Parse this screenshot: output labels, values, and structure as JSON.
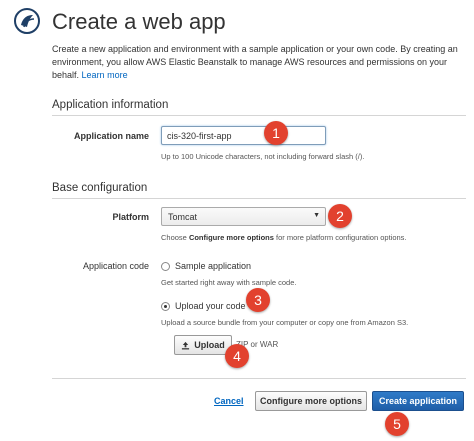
{
  "header": {
    "title": "Create a web app",
    "intro": "Create a new application and environment with a sample application or your own code. By creating an environment, you allow AWS Elastic Beanstalk to manage AWS resources and permissions on your behalf.",
    "learn_more": "Learn more"
  },
  "app_info": {
    "section_title": "Application information",
    "name_label": "Application name",
    "name_value": "cis-320-first-app",
    "name_hint": "Up to 100 Unicode characters, not including forward slash (/)."
  },
  "base_config": {
    "section_title": "Base configuration",
    "platform_label": "Platform",
    "platform_value": "Tomcat",
    "platform_hint_pre": "Choose ",
    "platform_hint_bold": "Configure more options",
    "platform_hint_post": " for more platform configuration options.",
    "code_label": "Application code",
    "sample_label": "Sample application",
    "sample_hint": "Get started right away with sample code.",
    "upload_label": "Upload your code",
    "upload_hint": "Upload a source bundle from your computer or copy one from Amazon S3.",
    "upload_button": "Upload",
    "upload_format": "ZIP or WAR"
  },
  "footer": {
    "cancel": "Cancel",
    "configure_more": "Configure more options",
    "create": "Create application"
  },
  "markers": [
    "1",
    "2",
    "3",
    "4",
    "5"
  ],
  "colors": {
    "accent": "#2f7bc8",
    "link": "#0066c0",
    "marker": "#e2412e"
  },
  "icons": {
    "logo": "elastic-beanstalk-logo",
    "upload": "upload-icon",
    "dropdown": "chevron-down-icon"
  }
}
